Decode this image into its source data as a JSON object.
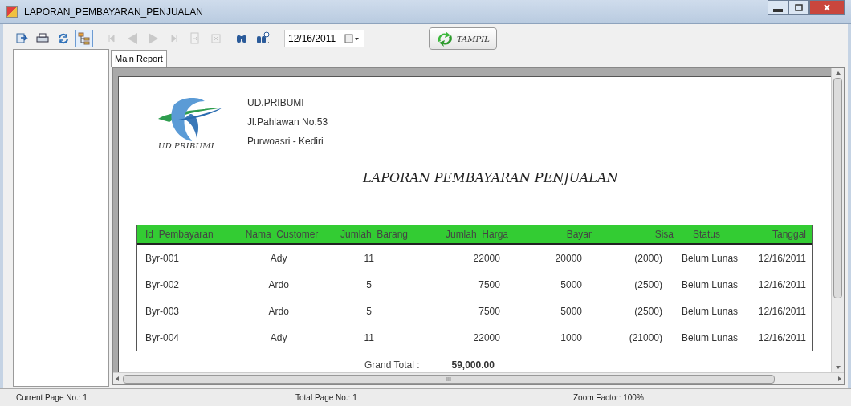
{
  "window": {
    "title": "LAPORAN_PEMBAYARAN_PENJUALAN"
  },
  "toolbar": [
    {
      "kind": "export",
      "disabled": false,
      "on": false
    },
    {
      "kind": "print",
      "disabled": false,
      "on": false
    },
    {
      "kind": "refresh",
      "disabled": false,
      "on": false
    },
    {
      "kind": "tree",
      "disabled": false,
      "on": true
    },
    {
      "kind": "first",
      "disabled": true,
      "on": false
    },
    {
      "kind": "prev",
      "disabled": true,
      "on": false
    },
    {
      "kind": "next",
      "disabled": true,
      "on": false
    },
    {
      "kind": "last",
      "disabled": true,
      "on": false
    },
    {
      "kind": "goto",
      "disabled": true,
      "on": false
    },
    {
      "kind": "stop",
      "disabled": true,
      "on": false
    },
    {
      "kind": "find",
      "disabled": false,
      "on": false
    },
    {
      "kind": "zoom",
      "disabled": false,
      "on": false
    }
  ],
  "date_picker": {
    "value": "12/16/2011"
  },
  "show_button": {
    "label": "TAMPIL"
  },
  "tabs": [
    {
      "label": "Main Report",
      "selected": true
    }
  ],
  "report": {
    "company": {
      "logo_text": "UD.PRIBUMI",
      "lines": [
        "UD.PRIBUMI",
        "Jl.Pahlawan No.53",
        "Purwoasri - Kediri"
      ]
    },
    "title": "LAPORAN PEMBAYARAN PENJUALAN",
    "table": {
      "columns": [
        "Id  Pembayaran",
        "Nama  Customer",
        "Jumlah  Barang",
        "Jumlah  Harga",
        "Bayar",
        "Sisa",
        "Status",
        "Tanggal"
      ],
      "rows": [
        [
          "Byr-001",
          "Ady",
          "11",
          "22000",
          "20000",
          "(2000)",
          "Belum Lunas",
          "12/16/2011"
        ],
        [
          "Byr-002",
          "Ardo",
          "5",
          "7500",
          "5000",
          "(2500)",
          "Belum Lunas",
          "12/16/2011"
        ],
        [
          "Byr-003",
          "Ardo",
          "5",
          "7500",
          "5000",
          "(2500)",
          "Belum Lunas",
          "12/16/2011"
        ],
        [
          "Byr-004",
          "Ady",
          "11",
          "22000",
          "1000",
          "(21000)",
          "Belum Lunas",
          "12/16/2011"
        ]
      ]
    },
    "grand_total": {
      "label": "Grand Total :",
      "value": "59,000.00"
    }
  },
  "horizontal_scroll_grip": "III",
  "status_bar": [
    "Current Page No.: 1",
    "Total Page No.: 1",
    "Zoom Factor: 100%"
  ]
}
